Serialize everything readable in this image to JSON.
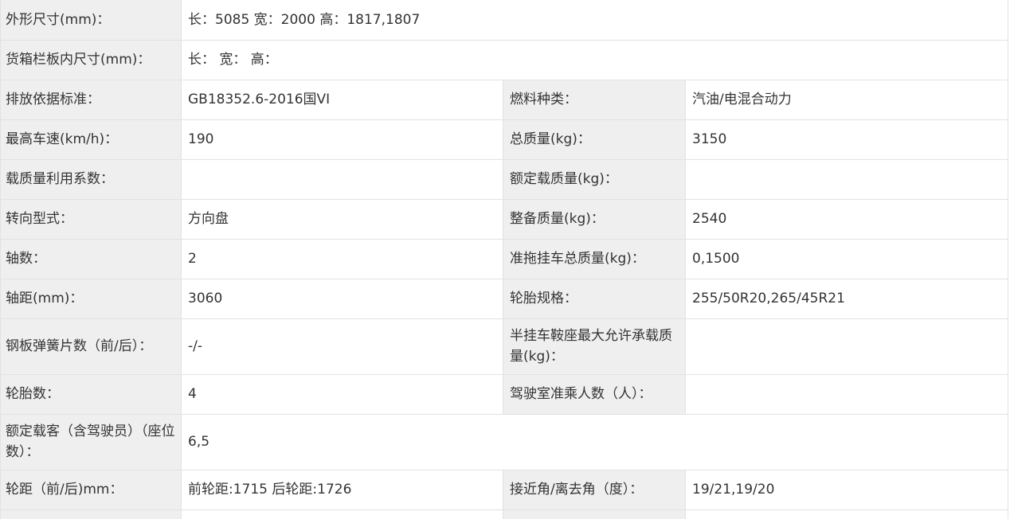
{
  "rows": [
    {
      "l1": "外形尺寸(mm)：",
      "v1": "长：5085 宽：2000 高：1817,1807"
    },
    {
      "l1": "货箱栏板内尺寸(mm)：",
      "v1": "长： 宽： 高："
    },
    {
      "l1": "排放依据标准：",
      "v1": "GB18352.6-2016国VI",
      "l2": "燃料种类：",
      "v2": "汽油/电混合动力"
    },
    {
      "l1": "最高车速(km/h)：",
      "v1": "190",
      "l2": "总质量(kg)：",
      "v2": "3150"
    },
    {
      "l1": "载质量利用系数：",
      "v1": "",
      "l2": "额定载质量(kg)：",
      "v2": ""
    },
    {
      "l1": "转向型式：",
      "v1": "方向盘",
      "l2": "整备质量(kg)：",
      "v2": "2540"
    },
    {
      "l1": "轴数：",
      "v1": "2",
      "l2": "准拖挂车总质量(kg)：",
      "v2": "0,1500"
    },
    {
      "l1": "轴距(mm)：",
      "v1": "3060",
      "l2": "轮胎规格：",
      "v2": "255/50R20,265/45R21"
    },
    {
      "l1": "钢板弹簧片数（前/后）：",
      "v1": "-/-",
      "l2": "半挂车鞍座最大允许承载质量(kg)：",
      "v2": ""
    },
    {
      "l1": "轮胎数：",
      "v1": "4",
      "l2": "驾驶室准乘人数（人）：",
      "v2": ""
    },
    {
      "l1": "额定载客（含驾驶员）（座位数）：",
      "v1": "6,5"
    },
    {
      "l1": "轮距（前/后)mm：",
      "v1": "前轮距:1715 后轮距:1726",
      "l2": "接近角/离去角（度）：",
      "v2": "19/21,19/20"
    }
  ]
}
